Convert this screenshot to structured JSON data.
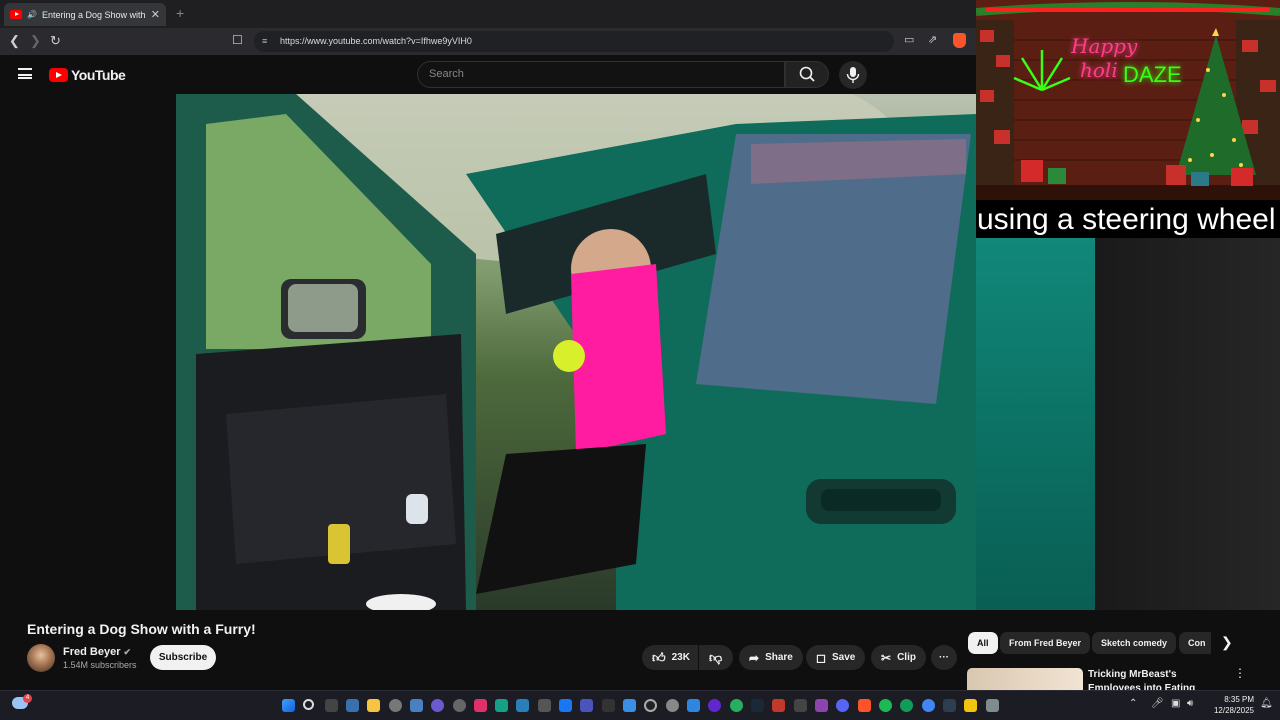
{
  "browser": {
    "tab_title": "Entering a Dog Show with a Furry!",
    "url": "https://www.youtube.com/watch?v=Ifhwe9yVIH0",
    "new_tab": "+"
  },
  "youtube": {
    "logo_text": "YouTube",
    "search_placeholder": "Search"
  },
  "overlay": {
    "sign_line1": "Happy",
    "sign_line2_a": "holi",
    "sign_line2_b": "DAZE",
    "caption": "using a steering wheel"
  },
  "video": {
    "title": "Entering a Dog Show with a Furry!",
    "channel": "Fred Beyer",
    "subscribers": "1.54M subscribers",
    "subscribe_label": "Subscribe",
    "likes": "23K",
    "share_label": "Share",
    "save_label": "Save",
    "clip_label": "Clip",
    "more_label": "···"
  },
  "chips": [
    "All",
    "From Fred Beyer",
    "Sketch comedy",
    "Con"
  ],
  "recommended": {
    "title": "Tricking MrBeast's Employees into Eating Hershey..."
  },
  "taskbar": {
    "time": "8:35 PM",
    "date": "12/28/2025",
    "notif_badge": "4"
  },
  "colors": {
    "youtube_red": "#ff0000",
    "background": "#0f0f0f",
    "neon_green": "#39ff14",
    "neon_pink": "#ff3d8b"
  }
}
